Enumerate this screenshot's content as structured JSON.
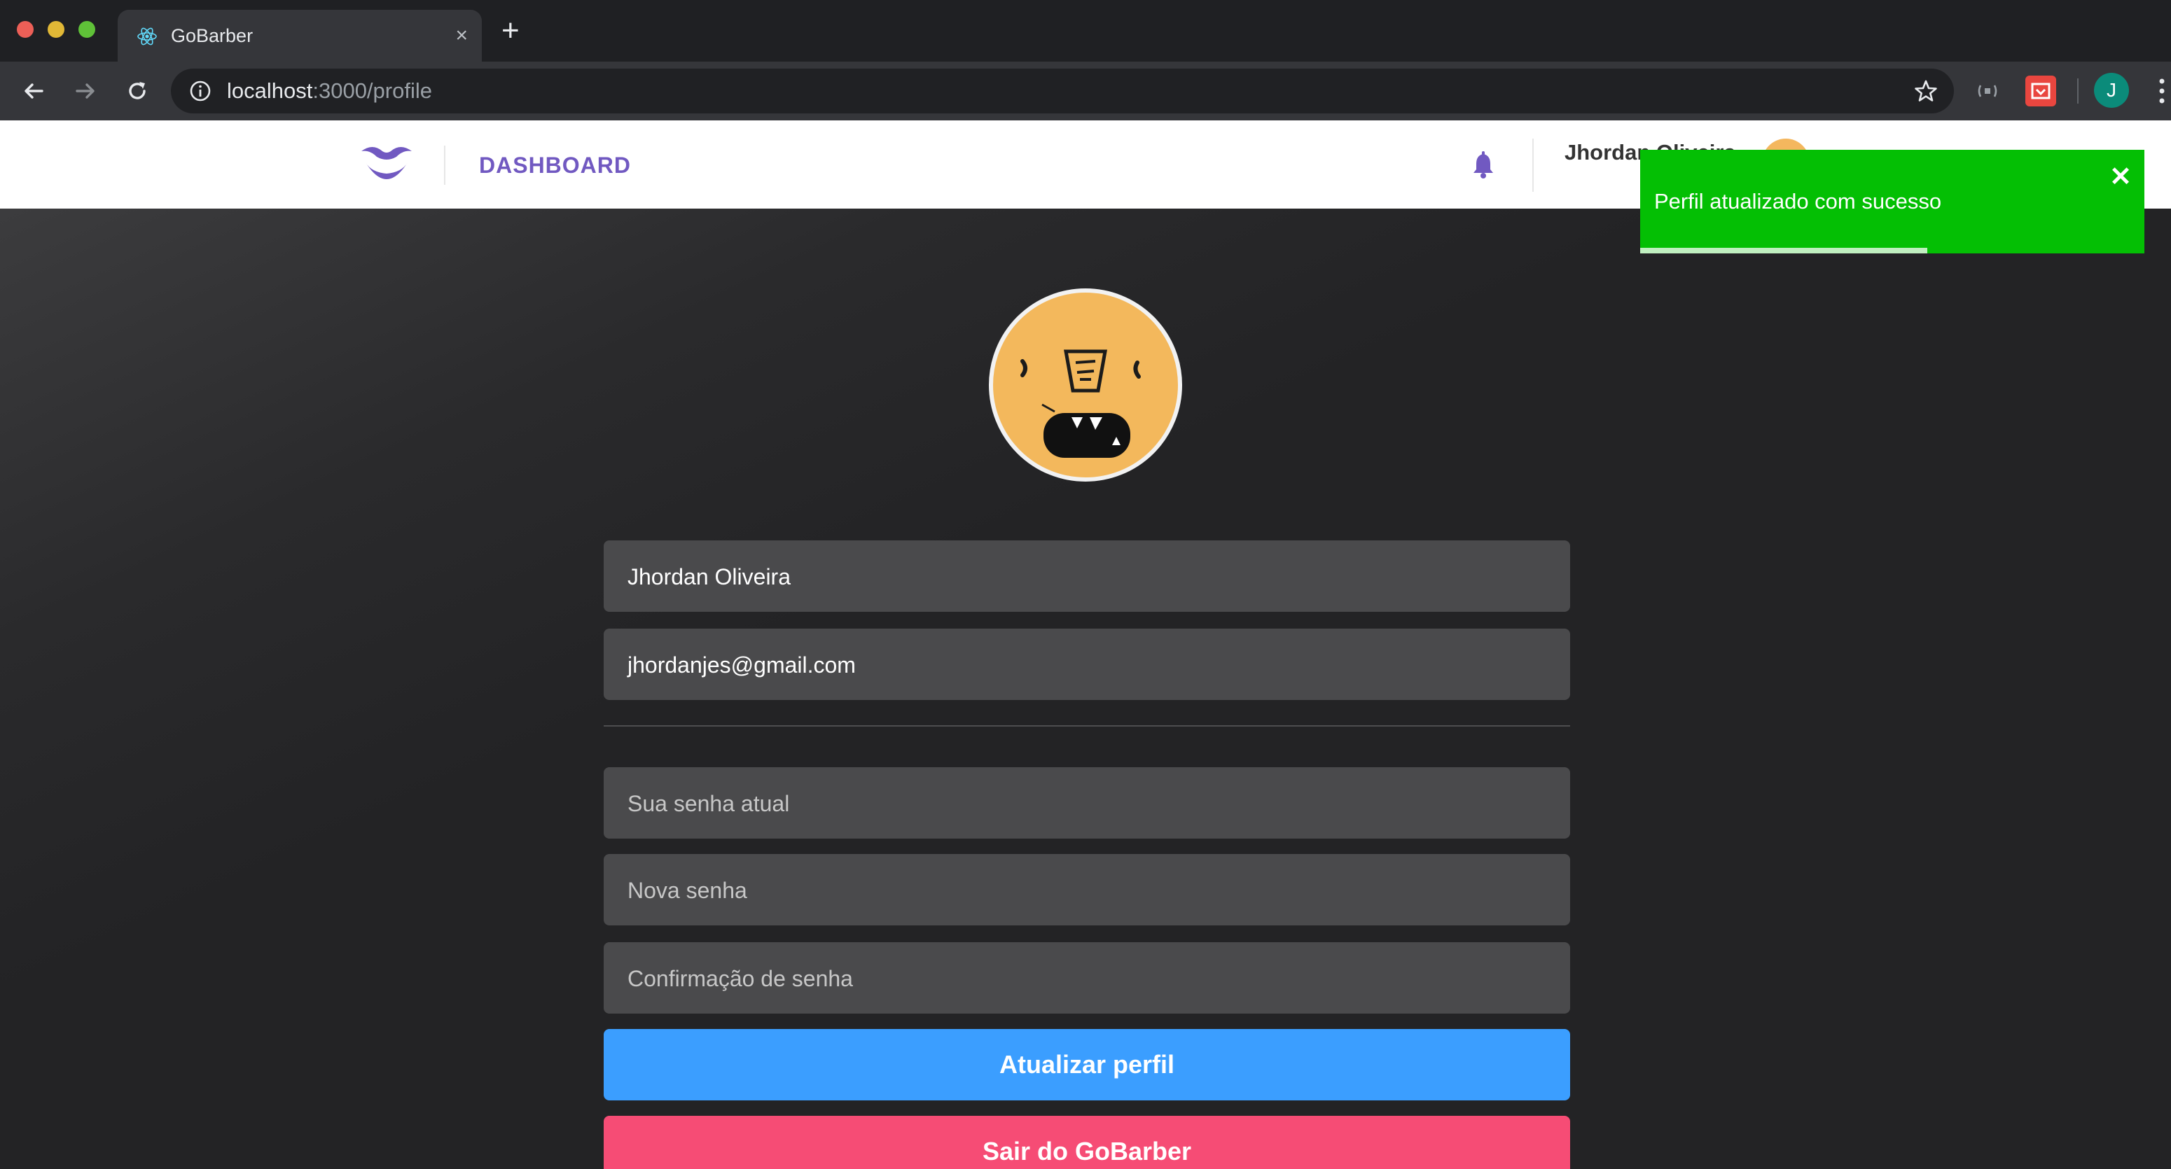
{
  "browser": {
    "tab_title": "GoBarber",
    "url_host": "localhost",
    "url_rest": ":3000/profile",
    "profile_initial": "J"
  },
  "header": {
    "nav_label": "DASHBOARD",
    "user_name": "Jhordan Oliveira"
  },
  "form": {
    "name_value": "Jhordan Oliveira",
    "email_value": "jhordanjes@gmail.com",
    "old_password_placeholder": "Sua senha atual",
    "new_password_placeholder": "Nova senha",
    "confirm_password_placeholder": "Confirmação de senha",
    "submit_label": "Atualizar perfil",
    "signout_label": "Sair do GoBarber"
  },
  "toast": {
    "message": "Perfil atualizado com sucesso",
    "close_glyph": "✕",
    "progress_fraction": 0.57
  },
  "colors": {
    "brand": "#7159c1",
    "submit": "#3b9eff",
    "signout": "#f64c75",
    "toast_success": "#04bf04"
  }
}
